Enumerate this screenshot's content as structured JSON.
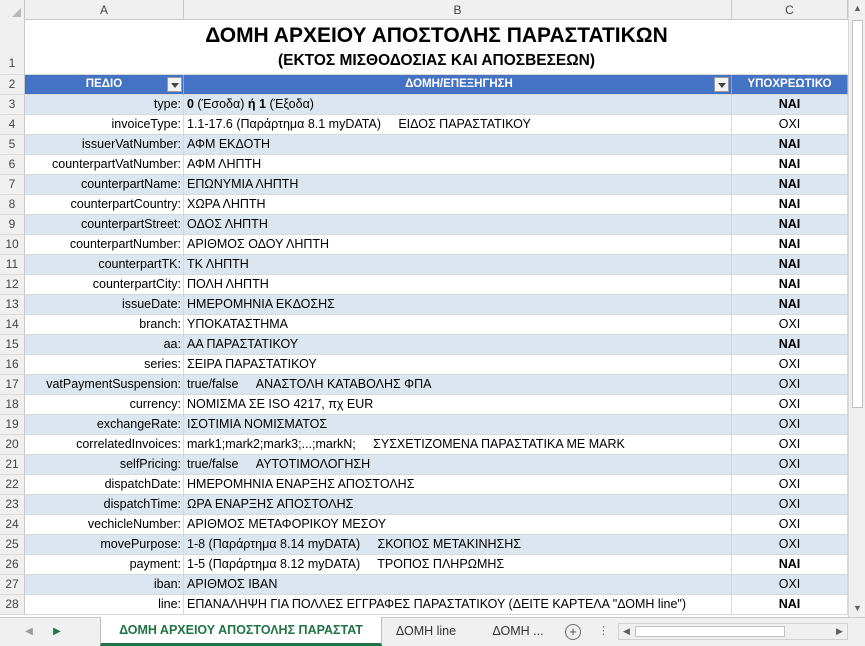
{
  "columns": [
    "A",
    "B",
    "C"
  ],
  "title": {
    "row_num": "1",
    "line1": "ΔΟΜΗ ΑΡΧΕΙΟΥ ΑΠΟΣΤΟΛΗΣ ΠΑΡΑΣΤΑΤΙΚΩΝ",
    "line2": "(ΕΚΤΟΣ ΜΙΣΘΟΔΟΣΙΑΣ ΚΑΙ ΑΠΟΣΒΕΣΕΩΝ)"
  },
  "header": {
    "row_num": "2",
    "field": "ΠΕΔΙΟ",
    "structure": "ΔΟΜΗ/ΕΠΕΞΗΓΗΣΗ",
    "required": "ΥΠΟΧΡΕΩΤΙΚΟ"
  },
  "rows": [
    {
      "n": "3",
      "field": "type:",
      "desc": "",
      "req": "ΝΑΙ"
    },
    {
      "n": "4",
      "field": "invoiceType:",
      "desc": "1.1-17.6 (Παράρτημα 8.1 myDATA)     ΕΙΔΟΣ ΠΑΡΑΣΤΑΤΙΚΟΥ",
      "req": "ΟΧΙ"
    },
    {
      "n": "5",
      "field": "issuerVatNumber:",
      "desc": "ΑΦΜ ΕΚΔΟΤΗ",
      "req": "ΝΑΙ"
    },
    {
      "n": "6",
      "field": "counterpartVatNumber:",
      "desc": "ΑΦΜ ΛΗΠΤΗ",
      "req": "ΝΑΙ"
    },
    {
      "n": "7",
      "field": "counterpartName:",
      "desc": "ΕΠΩΝΥΜΙΑ ΛΗΠΤΗ",
      "req": "ΝΑΙ"
    },
    {
      "n": "8",
      "field": "counterpartCountry:",
      "desc": "ΧΩΡΑ ΛΗΠΤΗ",
      "req": "ΝΑΙ"
    },
    {
      "n": "9",
      "field": "counterpartStreet:",
      "desc": "ΟΔΟΣ ΛΗΠΤΗ",
      "req": "ΝΑΙ"
    },
    {
      "n": "10",
      "field": "counterpartNumber:",
      "desc": "ΑΡΙΘΜΟΣ ΟΔΟΥ ΛΗΠΤΗ",
      "req": "ΝΑΙ"
    },
    {
      "n": "11",
      "field": "counterpartTK:",
      "desc": "ΤΚ ΛΗΠΤΗ",
      "req": "ΝΑΙ"
    },
    {
      "n": "12",
      "field": "counterpartCity:",
      "desc": "ΠΟΛΗ ΛΗΠΤΗ",
      "req": "ΝΑΙ"
    },
    {
      "n": "13",
      "field": "issueDate:",
      "desc": "ΗΜΕΡΟΜΗΝΙΑ ΕΚΔΟΣΗΣ",
      "req": "ΝΑΙ"
    },
    {
      "n": "14",
      "field": "branch:",
      "desc": "ΥΠΟΚΑΤΑΣΤΗΜΑ",
      "req": "ΟΧΙ"
    },
    {
      "n": "15",
      "field": "aa:",
      "desc": "ΑΑ ΠΑΡΑΣΤΑΤΙΚΟΥ",
      "req": "ΝΑΙ"
    },
    {
      "n": "16",
      "field": "series:",
      "desc": "ΣΕΙΡΑ ΠΑΡΑΣΤΑΤΙΚΟΥ",
      "req": "ΟΧΙ"
    },
    {
      "n": "17",
      "field": "vatPaymentSuspension:",
      "desc": "true/false     ΑΝΑΣΤΟΛΗ ΚΑΤΑΒΟΛΗΣ ΦΠΑ",
      "req": "ΟΧΙ"
    },
    {
      "n": "18",
      "field": "currency:",
      "desc": "ΝΟΜΙΣΜΑ ΣΕ ISO 4217, πχ EUR",
      "req": "ΟΧΙ"
    },
    {
      "n": "19",
      "field": "exchangeRate:",
      "desc": "ΙΣΟΤΙΜΙΑ ΝΟΜΙΣΜΑΤΟΣ",
      "req": "ΟΧΙ"
    },
    {
      "n": "20",
      "field": "correlatedInvoices:",
      "desc": "mark1;mark2;mark3;...;markN;     ΣΥΣΧΕΤΙΖΟΜΕΝΑ ΠΑΡΑΣΤΑΤΙΚΑ ΜΕ MARK",
      "req": "ΟΧΙ"
    },
    {
      "n": "21",
      "field": "selfPricing:",
      "desc": "true/false     ΑΥΤΟΤΙΜΟΛΟΓΗΣΗ",
      "req": "ΟΧΙ"
    },
    {
      "n": "22",
      "field": "dispatchDate:",
      "desc": "ΗΜΕΡΟΜΗΝΙΑ ΕΝΑΡΞΗΣ ΑΠΟΣΤΟΛΗΣ",
      "req": "ΟΧΙ"
    },
    {
      "n": "23",
      "field": "dispatchTime:",
      "desc": "ΩΡΑ ΕΝΑΡΞΗΣ ΑΠΟΣΤΟΛΗΣ",
      "req": "ΟΧΙ"
    },
    {
      "n": "24",
      "field": "vechicleNumber:",
      "desc": "ΑΡΙΘΜΟΣ ΜΕΤΑΦΟΡΙΚΟΥ ΜΕΣΟΥ",
      "req": "ΟΧΙ"
    },
    {
      "n": "25",
      "field": "movePurpose:",
      "desc": "1-8 (Παράρτημα 8.14 myDATA)     ΣΚΟΠΟΣ ΜΕΤΑΚΙΝΗΣΗΣ",
      "req": "ΟΧΙ"
    },
    {
      "n": "26",
      "field": "payment:",
      "desc": "1-5 (Παράρτημα 8.12 myDATA)     ΤΡΟΠΟΣ ΠΛΗΡΩΜΗΣ",
      "req": "ΝΑΙ"
    },
    {
      "n": "27",
      "field": "iban:",
      "desc": "ΑΡΙΘΜΟΣ IBAN",
      "req": "ΟΧΙ"
    },
    {
      "n": "28",
      "field": "line:",
      "desc": "ΕΠΑΝΑΛΗΨΗ ΓΙΑ ΠΟΛΛΕΣ ΕΓΓΡΑΦΕΣ ΠΑΡΑΣΤΑΤΙΚΟΥ (ΔΕΙΤΕ ΚΑΡΤΕΛΑ \"ΔΟΜΗ line\")",
      "req": "ΝΑΙ"
    }
  ],
  "type_desc": {
    "v0": "0",
    "t0": " (Έσοδα) ",
    "or": "ή",
    "v1": " 1",
    "t1": " (Έξοδα)"
  },
  "tabs": [
    {
      "label": "ΔΟΜΗ ΑΡΧΕΙΟΥ ΑΠΟΣΤΟΛΗΣ ΠΑΡΑΣΤΑΤ",
      "active": true
    },
    {
      "label": "ΔΟΜΗ line",
      "active": false
    },
    {
      "label": "ΔΟΜΗ ...",
      "active": false
    }
  ],
  "colors": {
    "header_bg": "#4472c4",
    "band_bg": "#dce6f1",
    "active_tab": "#217346"
  }
}
